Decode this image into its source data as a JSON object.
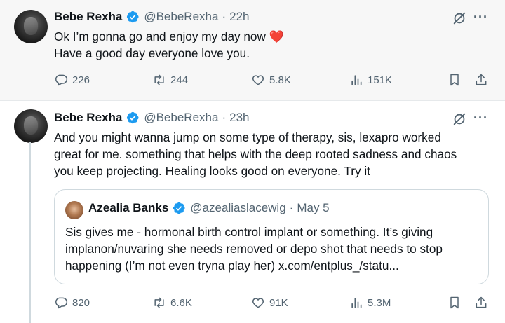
{
  "tweets": [
    {
      "name": "Bebe Rexha",
      "handle": "@BebeRexha",
      "separator": "·",
      "time": "22h",
      "lines": [
        "Ok I’m gonna go and enjoy my day now",
        "Have a good day everyone love you."
      ],
      "heart_emoji": "❤️",
      "stats": {
        "replies": "226",
        "reposts": "244",
        "likes": "5.8K",
        "views": "151K"
      }
    },
    {
      "name": "Bebe Rexha",
      "handle": "@BebeRexha",
      "separator": "·",
      "time": "23h",
      "lines": [
        "And you might wanna jump on some type of therapy, sis, lexapro worked",
        "great for me. something that helps with the deep rooted sadness and chaos",
        "you keep projecting. Healing looks good on everyone. Try it"
      ],
      "quote": {
        "name": "Azealia Banks",
        "handle": "@azealiaslacewig",
        "separator": "·",
        "time": "May 5",
        "lines": [
          "Sis gives me -  hormonal birth control implant or something. It’s giving",
          "implanon/nuvaring she needs removed or depo shot that needs to stop",
          "happening (I’m not even tryna play her) x.com/entplus_/statu..."
        ]
      },
      "stats": {
        "replies": "820",
        "reposts": "6.6K",
        "likes": "91K",
        "views": "5.3M"
      }
    }
  ],
  "icons": {
    "verified": "verified-badge-icon",
    "grok": "grok-icon",
    "more": "more-icon",
    "reply": "reply-icon",
    "repost": "repost-icon",
    "like": "like-icon",
    "views": "views-icon",
    "bookmark": "bookmark-icon",
    "share": "share-icon"
  },
  "colors": {
    "verified": "#1d9bf0",
    "text": "#0f1419",
    "muted": "#536471",
    "heart": "#d61f3a"
  },
  "more_label": "···"
}
